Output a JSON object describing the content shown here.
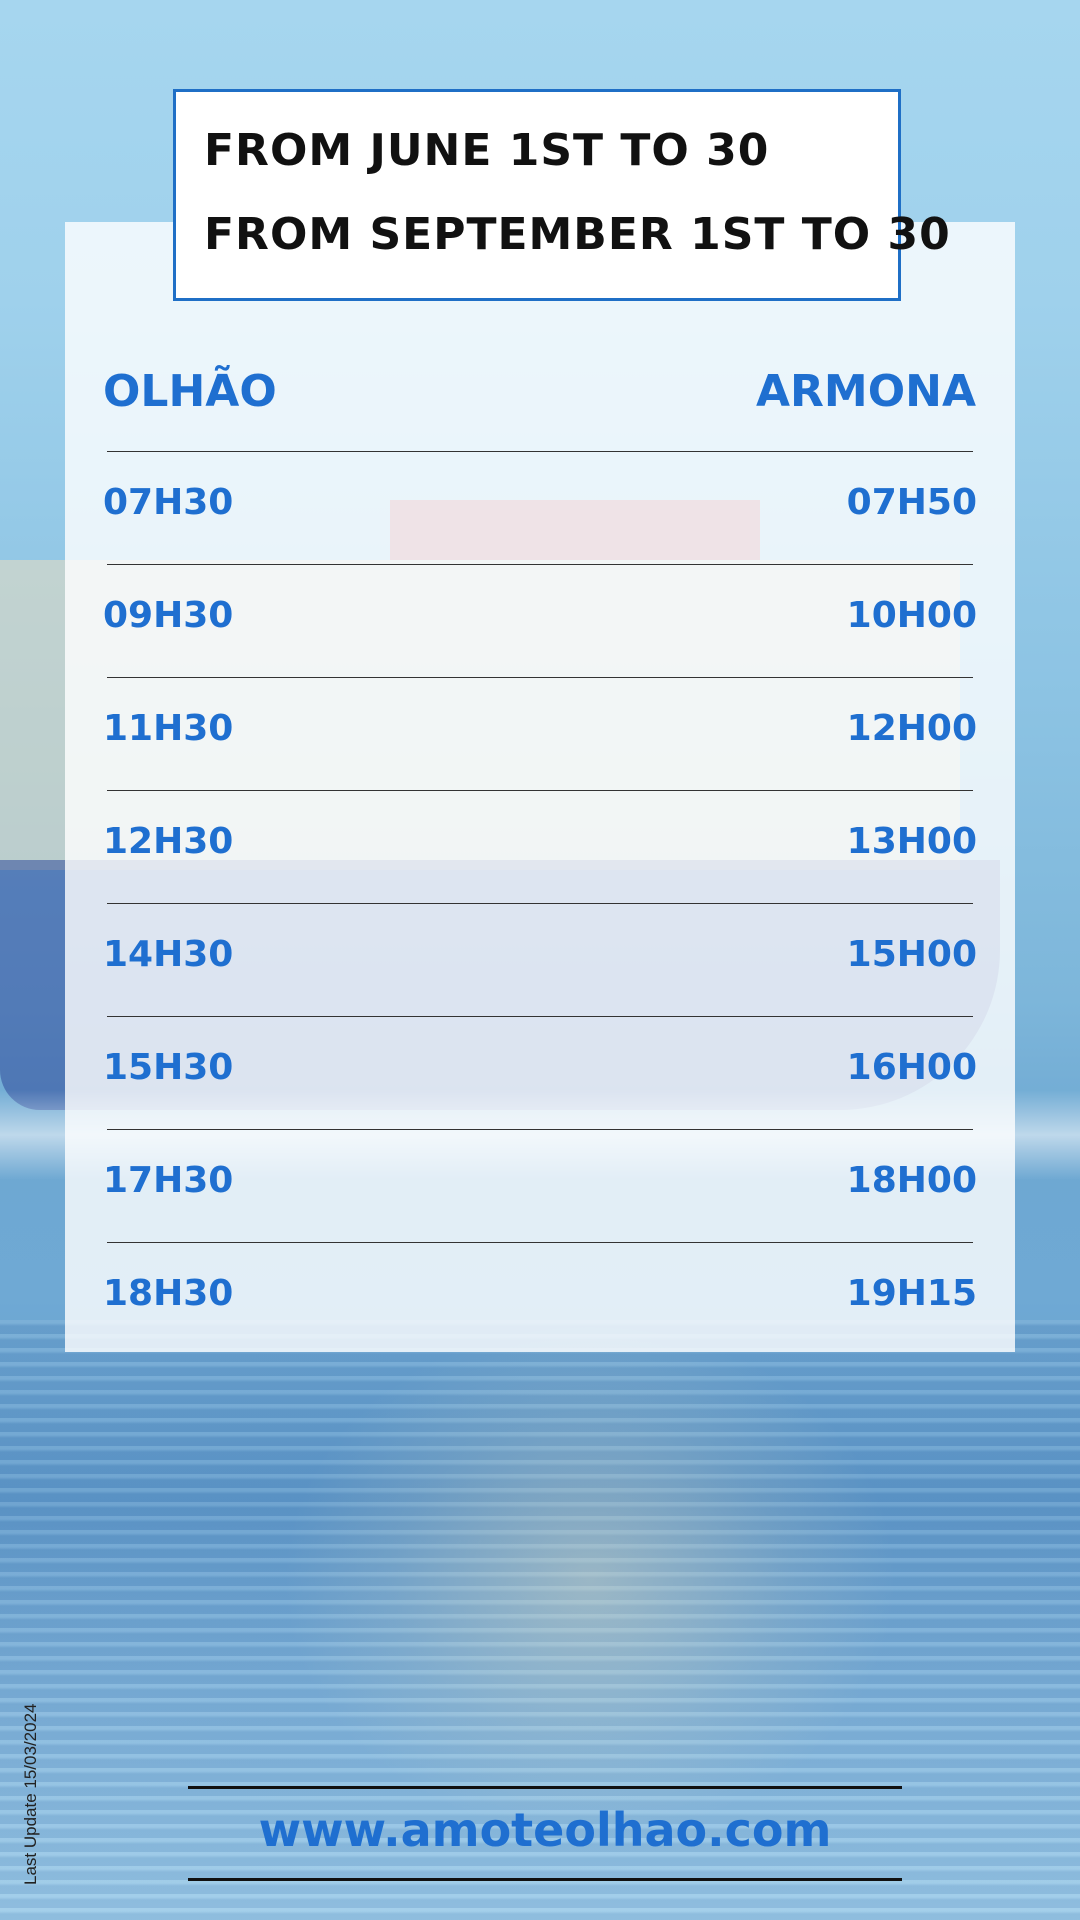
{
  "dates": {
    "line1": "FROM JUNE 1ST TO 30",
    "line2": "FROM SEPTEMBER 1ST TO 30"
  },
  "schedule": {
    "from_label": "OLHÃO",
    "to_label": "ARMONA",
    "rows": [
      {
        "olhao": "07H30",
        "armona": "07H50"
      },
      {
        "olhao": "09H30",
        "armona": "10H00"
      },
      {
        "olhao": "11H30",
        "armona": "12H00"
      },
      {
        "olhao": "12H30",
        "armona": "13H00"
      },
      {
        "olhao": "14H30",
        "armona": "15H00"
      },
      {
        "olhao": "15H30",
        "armona": "16H00"
      },
      {
        "olhao": "17H30",
        "armona": "18H00"
      },
      {
        "olhao": "18H30",
        "armona": "19H15"
      }
    ]
  },
  "footer": {
    "website": "www.amoteolhao.com",
    "last_update": "Last Update 15/03/2024"
  },
  "colors": {
    "accent_blue": "#1f6fd0",
    "box_border": "#1f6fc6",
    "text_dark": "#111111"
  }
}
